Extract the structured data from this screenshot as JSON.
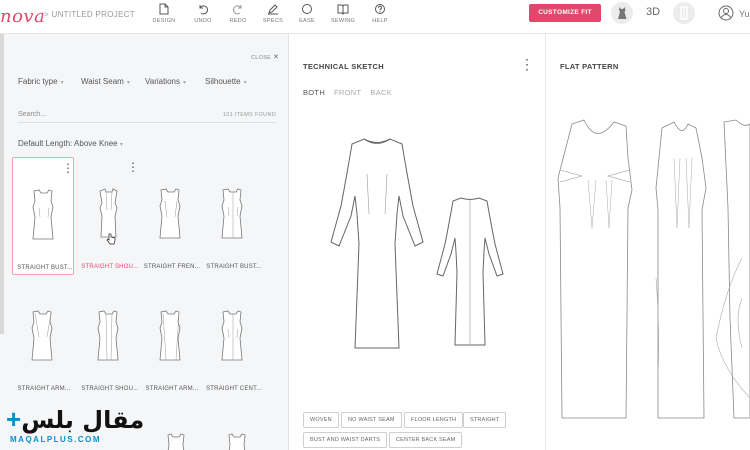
{
  "app": {
    "logo_text": "nova",
    "breadcrumb": "> UNTITLED PROJECT"
  },
  "toolbar": {
    "items": [
      {
        "label": "DESIGN",
        "icon": "page-icon"
      },
      {
        "label": "UNDO",
        "icon": "undo-icon"
      },
      {
        "label": "REDO",
        "icon": "redo-icon"
      },
      {
        "label": "SPECS",
        "icon": "pencil-icon"
      },
      {
        "label": "EASE",
        "icon": "circle-icon"
      },
      {
        "label": "SEWING",
        "icon": "book-icon"
      },
      {
        "label": "HELP",
        "icon": "help-icon"
      }
    ],
    "customize_label": "CUSTOMIZE FIT",
    "view_3d_label": "3D",
    "user_initials": "Yu"
  },
  "library": {
    "close_label": "CLOSE",
    "filters": [
      "Fabric type",
      "Waist Seam",
      "Variations",
      "Silhouette"
    ],
    "search_placeholder": "Search...",
    "items_found": "101 ITEMS FOUND",
    "default_length": "Default Length: Above Knee",
    "items": [
      {
        "label": "STRAIGHT BUST...",
        "selected": true
      },
      {
        "label": "STRAIGHT SHOU...",
        "selected": false,
        "hovered": true
      },
      {
        "label": "STRAIGHT FREN...",
        "selected": false
      },
      {
        "label": "STRAIGHT BUST...",
        "selected": false
      },
      {
        "label": "STRAIGHT ARM...",
        "selected": false
      },
      {
        "label": "STRAIGHT SHOU...",
        "selected": false
      },
      {
        "label": "STRAIGHT ARM...",
        "selected": false
      },
      {
        "label": "STRAIGHT CENT...",
        "selected": false
      }
    ]
  },
  "sketch": {
    "title": "TECHNICAL SKETCH",
    "views": [
      "BOTH",
      "FRONT",
      "BACK"
    ],
    "active_view": "BOTH",
    "tags": [
      "WOVEN",
      "NO WAIST SEAM",
      "FLOOR LENGTH",
      "STRAIGHT",
      "BUST AND WAIST DARTS",
      "CENTER BACK SEAM"
    ]
  },
  "pattern": {
    "title": "FLAT PATTERN"
  },
  "watermark": {
    "main": "مقال بلس",
    "plus": "+",
    "sub": "MAQALPLUS.COM"
  },
  "colors": {
    "accent": "#e0486c",
    "watermark_blue": "#0a8fd0"
  }
}
